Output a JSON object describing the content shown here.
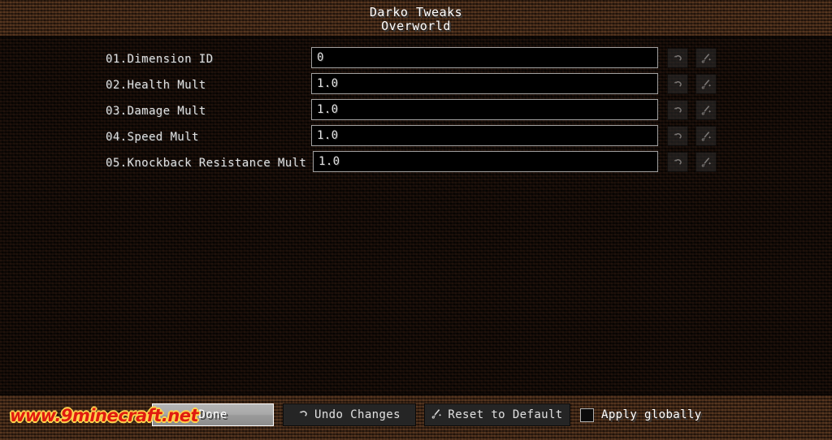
{
  "window": {
    "title": "Darko Tweaks",
    "subtitle": "Overworld"
  },
  "options": [
    {
      "label": "01.Dimension ID",
      "value": "0",
      "undo_icon": "undo-arrow-icon",
      "reset_icon": "reset-wand-icon"
    },
    {
      "label": "02.Health Mult",
      "value": "1.0",
      "undo_icon": "undo-arrow-icon",
      "reset_icon": "reset-wand-icon"
    },
    {
      "label": "03.Damage Mult",
      "value": "1.0",
      "undo_icon": "undo-arrow-icon",
      "reset_icon": "reset-wand-icon"
    },
    {
      "label": "04.Speed Mult",
      "value": "1.0",
      "undo_icon": "undo-arrow-icon",
      "reset_icon": "reset-wand-icon"
    },
    {
      "label": "05.Knockback Resistance Mult",
      "value": "1.0",
      "undo_icon": "undo-arrow-icon",
      "reset_icon": "reset-wand-icon"
    }
  ],
  "footer": {
    "done_label": "Done",
    "undo_label": "Undo Changes",
    "reset_label": "Reset to Default",
    "apply_globally_label": "Apply globally",
    "apply_globally_checked": false
  },
  "watermark": {
    "text": "www.9minecraft.net"
  },
  "colors": {
    "dirt": "#342014",
    "body": "#0d0705",
    "field_border": "#a0a0a0",
    "text": "#e0e0e0",
    "title_text": "#ffffff",
    "watermark_fill": "#e01b10",
    "watermark_outline": "#ffd34d"
  }
}
